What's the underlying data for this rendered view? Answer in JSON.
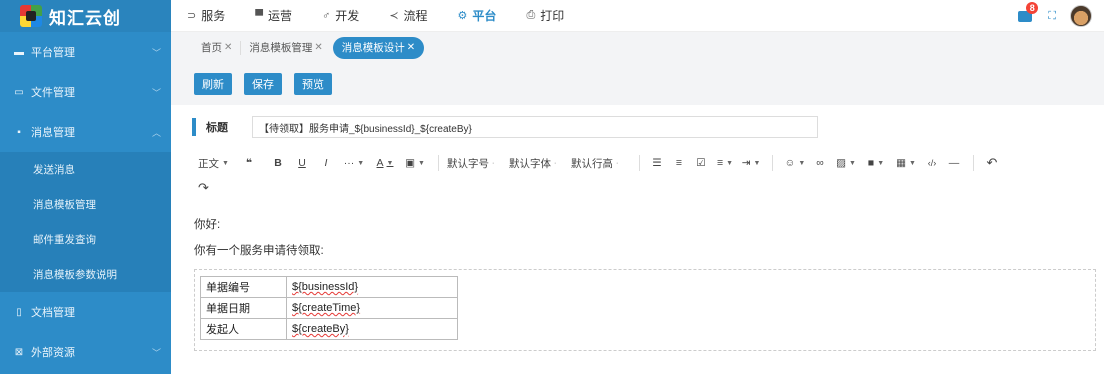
{
  "brand": {
    "name": "知汇云创"
  },
  "sidebar": {
    "items": [
      {
        "label": "平台管理",
        "icon": "monitor-icon"
      },
      {
        "label": "文件管理",
        "icon": "folder-icon"
      },
      {
        "label": "消息管理",
        "icon": "message-icon",
        "expanded": true,
        "children": [
          "发送消息",
          "消息模板管理",
          "邮件重发查询",
          "消息模板参数说明"
        ]
      },
      {
        "label": "文档管理",
        "icon": "document-icon"
      },
      {
        "label": "外部资源",
        "icon": "image-icon"
      }
    ]
  },
  "topnav": {
    "items": [
      {
        "label": "服务",
        "icon": "service-icon"
      },
      {
        "label": "运营",
        "icon": "operation-icon"
      },
      {
        "label": "开发",
        "icon": "develop-icon"
      },
      {
        "label": "流程",
        "icon": "share-icon"
      },
      {
        "label": "平台",
        "icon": "platform-icon",
        "active": true
      },
      {
        "label": "打印",
        "icon": "printer-icon"
      }
    ],
    "notification_count": "8"
  },
  "tabs": [
    {
      "label": "首页"
    },
    {
      "label": "消息模板管理"
    },
    {
      "label": "消息模板设计",
      "active": true
    }
  ],
  "actions": {
    "refresh": "刷新",
    "save": "保存",
    "preview": "预览"
  },
  "editor": {
    "title_label": "标题",
    "title_value": "【待领取】服务申请_${businessId}_${createBy}",
    "toolbar": {
      "paragraph": "正文",
      "font_size": "默认字号",
      "font_family": "默认字体",
      "line_height": "默认行高"
    },
    "greeting": "你好:",
    "message": "你有一个服务申请待领取:",
    "table": [
      {
        "key": "单据编号",
        "value": "${businessId}"
      },
      {
        "key": "单据日期",
        "value": "${createTime}"
      },
      {
        "key": "发起人",
        "value": "${createBy}"
      }
    ]
  },
  "colors": {
    "primary": "#2d8cc8",
    "badge": "#f44336"
  }
}
